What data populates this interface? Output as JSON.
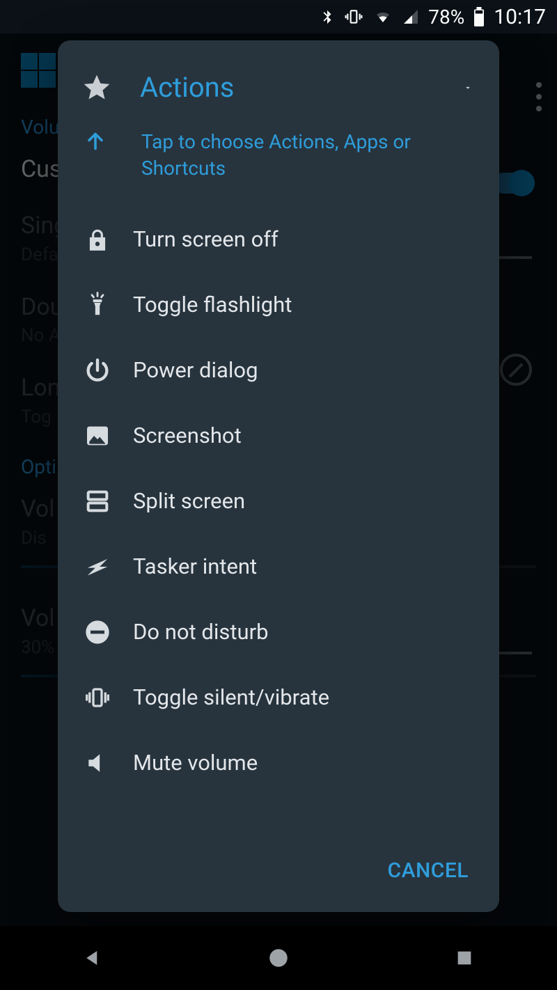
{
  "status": {
    "battery": "78%",
    "time": "10:17"
  },
  "background": {
    "section_volume": "Volu",
    "custom": "Cus",
    "single_t": "Sing",
    "single_s": "Defa",
    "double_t": "Dou",
    "double_s": "No A",
    "long_t": "Lon",
    "long_s": "Tog",
    "section_options": "Opti",
    "vol_t": "Vol",
    "vol_s": "Dis",
    "vol30_t": "Vol",
    "vol30_s": "30%"
  },
  "dialog": {
    "title": "Actions",
    "hint": "Tap to choose Actions, Apps or Shortcuts",
    "items": [
      {
        "icon": "lock-icon",
        "label": "Turn screen off"
      },
      {
        "icon": "flashlight-icon",
        "label": "Toggle flashlight"
      },
      {
        "icon": "power-icon",
        "label": "Power dialog"
      },
      {
        "icon": "image-icon",
        "label": "Screenshot"
      },
      {
        "icon": "split-icon",
        "label": "Split screen"
      },
      {
        "icon": "bolt-icon",
        "label": "Tasker intent"
      },
      {
        "icon": "dnd-icon",
        "label": "Do not disturb"
      },
      {
        "icon": "vibrate-icon",
        "label": "Toggle silent/vibrate"
      },
      {
        "icon": "mute-icon",
        "label": "Mute volume"
      }
    ],
    "cancel": "CANCEL"
  }
}
